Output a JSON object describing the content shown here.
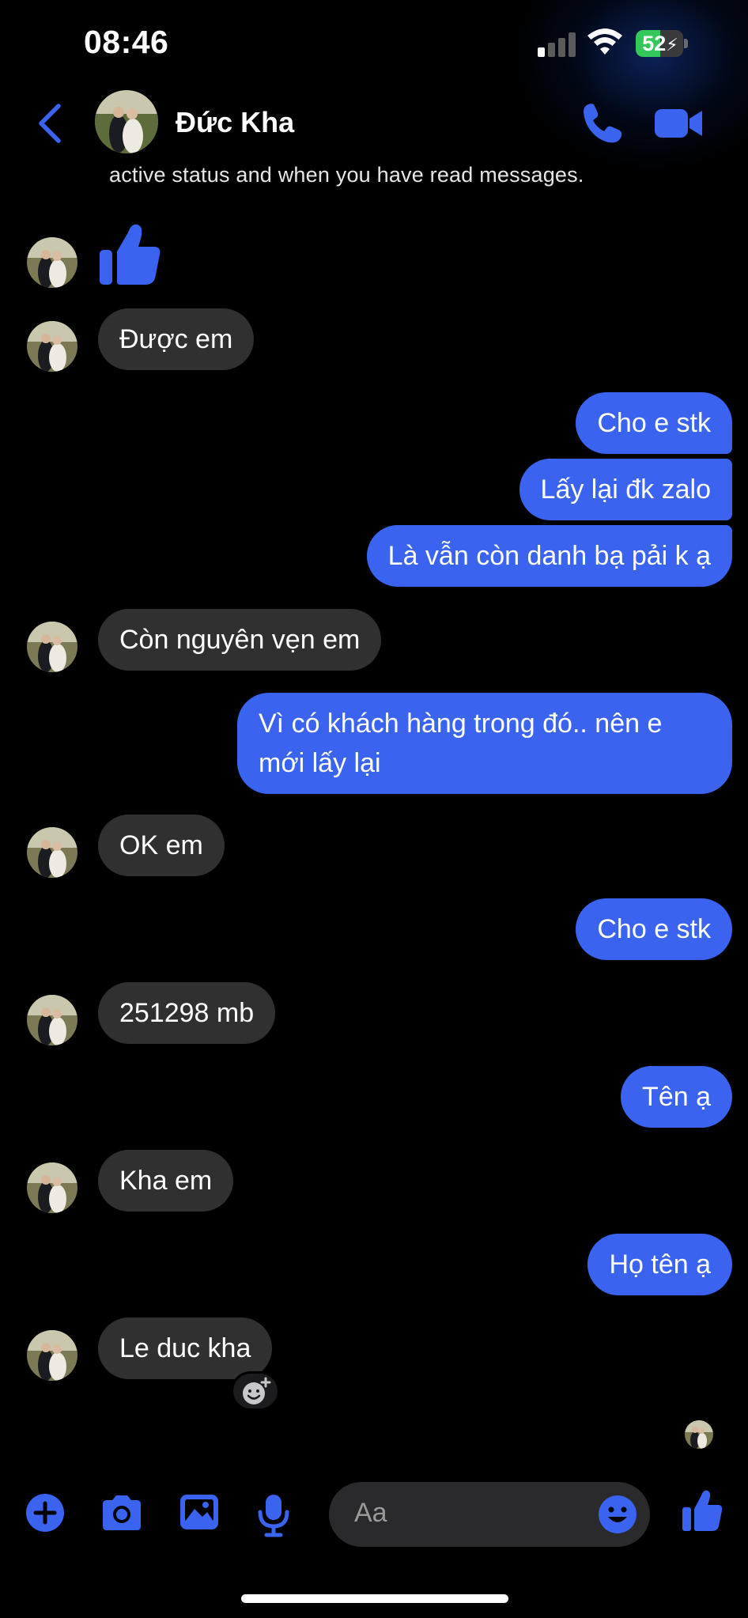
{
  "status_bar": {
    "time": "08:46",
    "battery": "52",
    "battery_level_percent": 52,
    "signal_bars_active": 1,
    "signal_bars_total": 4
  },
  "header": {
    "contact_name": "Đức Kha",
    "back_icon": "chevron-left-icon",
    "call_icon": "phone-icon",
    "video_icon": "video-camera-icon"
  },
  "notice": "active status and when you have read messages.",
  "messages": [
    {
      "from": "them",
      "type": "like"
    },
    {
      "from": "them",
      "text": "Được em"
    },
    {
      "from": "me",
      "text": "Cho e stk"
    },
    {
      "from": "me",
      "text": "Lấy lại đk zalo"
    },
    {
      "from": "me",
      "text": "Là vẫn còn danh bạ pải k ạ"
    },
    {
      "from": "them",
      "text": "Còn nguyên vẹn em"
    },
    {
      "from": "me",
      "text": "Vì có khách hàng trong đó.. nên e mới lấy lại"
    },
    {
      "from": "them",
      "text": "OK em"
    },
    {
      "from": "me",
      "text": "Cho e stk"
    },
    {
      "from": "them",
      "text": "251298 mb"
    },
    {
      "from": "me",
      "text": "Tên ạ"
    },
    {
      "from": "them",
      "text": "Kha em"
    },
    {
      "from": "me",
      "text": "Họ tên ạ"
    },
    {
      "from": "them",
      "text": "Le duc kha"
    }
  ],
  "composer": {
    "placeholder": "Aa",
    "icons": [
      "plus-icon",
      "camera-icon",
      "gallery-icon",
      "microphone-icon",
      "emoji-icon",
      "thumbs-up-icon"
    ]
  },
  "colors": {
    "accent": "#3a63f0",
    "incoming_bubble": "#303030",
    "background": "#000000",
    "battery_green": "#34c759"
  }
}
